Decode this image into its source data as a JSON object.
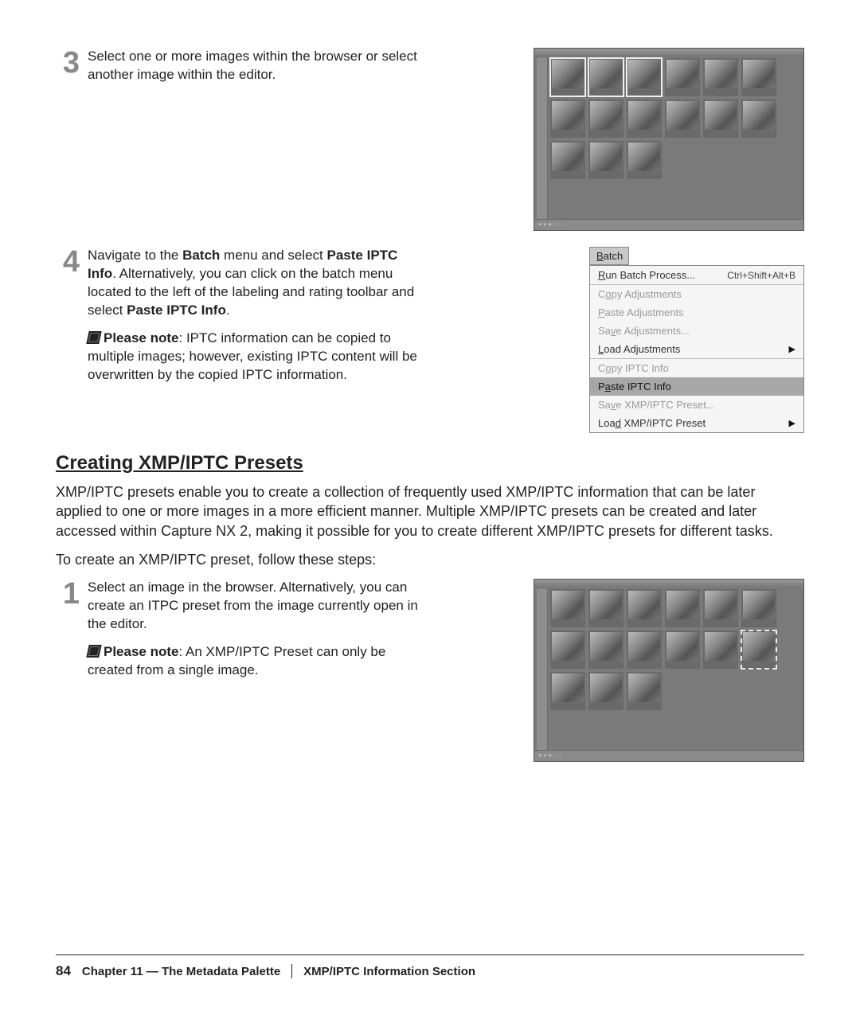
{
  "step3": {
    "num": "3",
    "text_a": "Select one or more images within the browser or select another image within the editor."
  },
  "step4": {
    "num": "4",
    "text_a": "Navigate to the ",
    "bold_a": "Batch",
    "text_b": " menu and select ",
    "bold_b": "Paste IPTC Info",
    "text_c": ". Alternatively, you can click on the batch menu located to the left of the labeling and rating toolbar and select ",
    "bold_c": "Paste IPTC Info",
    "text_d": ".",
    "note_label": "Please note",
    "note_text": ": IPTC information can be copied to multiple images; however, existing IPTC content will be overwritten by the copied IPTC information."
  },
  "batch_menu": {
    "header": "Batch",
    "items": [
      {
        "label": "Run Batch Process...",
        "u": "R",
        "shortcut": "Ctrl+Shift+Alt+B",
        "disabled": false
      },
      {
        "label": "Copy Adjustments",
        "u": "o",
        "disabled": true,
        "sep": true
      },
      {
        "label": "Paste Adjustments",
        "u": "P",
        "disabled": true
      },
      {
        "label": "Save Adjustments...",
        "u": "v",
        "disabled": true
      },
      {
        "label": "Load Adjustments",
        "u": "L",
        "arrow": true,
        "disabled": false
      },
      {
        "label": "Copy IPTC Info",
        "u": "o",
        "disabled": true,
        "sep": true
      },
      {
        "label": "Paste IPTC Info",
        "u": "a",
        "hl": true,
        "disabled": false
      },
      {
        "label": "Save XMP/IPTC Preset...",
        "u": "v",
        "disabled": true
      },
      {
        "label": "Load XMP/IPTC Preset",
        "u": "d",
        "arrow": true,
        "disabled": false
      }
    ]
  },
  "section": {
    "heading": "Creating XMP/IPTC Presets",
    "para1": "XMP/IPTC presets enable you to create a collection of frequently used XMP/IPTC information that can be later applied to one or more images in a more efficient manner. Multiple XMP/IPTC presets can be created and later accessed within Capture NX 2, making it possible for you to create different XMP/IPTC presets for different tasks.",
    "para2": "To create an XMP/IPTC preset, follow these steps:"
  },
  "step1b": {
    "num": "1",
    "text": "Select an image in the browser. Alternatively, you can create an ITPC preset from the image currently open in the editor.",
    "note_label": "Please note",
    "note_text": ": An XMP/IPTC Preset can only be created from a single image."
  },
  "footer": {
    "page": "84",
    "chapter": "Chapter 11 — The Metadata Palette",
    "section": "XMP/IPTC Information Section"
  },
  "thumb_ratings": "★★★☆☆"
}
